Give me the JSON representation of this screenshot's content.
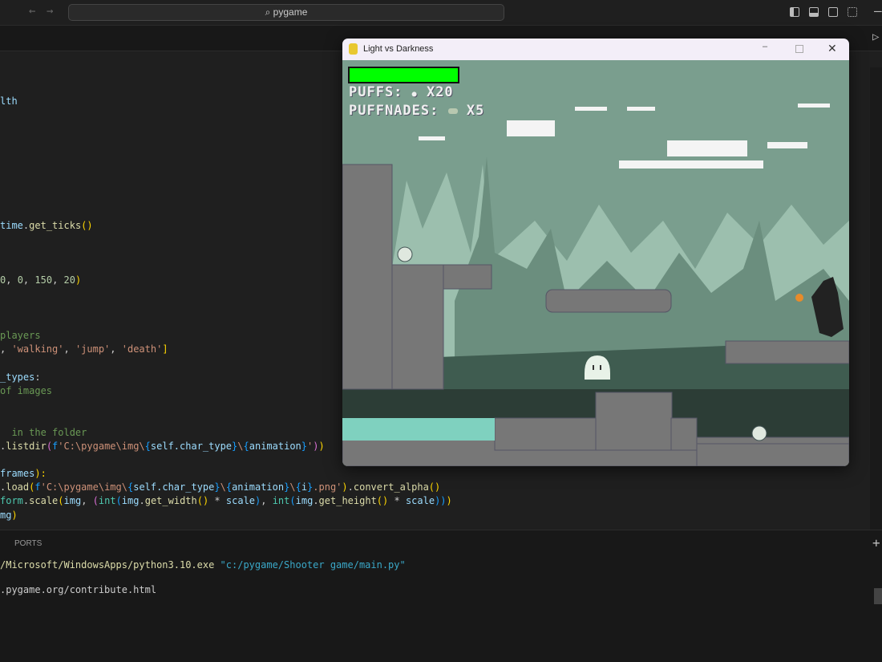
{
  "editor_titlebar": {
    "search_text": "pygame"
  },
  "code_lines": [
    {
      "parts": [
        [
          "k",
          "lth"
        ]
      ]
    },
    {
      "parts": [
        [
          "k",
          "time"
        ],
        [
          "w",
          "."
        ],
        [
          "f",
          "get_ticks"
        ],
        [
          "y",
          "()"
        ]
      ]
    },
    {
      "parts": [
        [
          "n",
          "0"
        ],
        [
          "w",
          ", "
        ],
        [
          "n",
          "0"
        ],
        [
          "w",
          ", "
        ],
        [
          "n",
          "150"
        ],
        [
          "w",
          ", "
        ],
        [
          "n",
          "20"
        ],
        [
          "y",
          ")"
        ]
      ]
    },
    {
      "parts": [
        [
          "c",
          "players"
        ]
      ]
    },
    {
      "parts": [
        [
          "w",
          ", "
        ],
        [
          "s",
          "'walking'"
        ],
        [
          "w",
          ", "
        ],
        [
          "s",
          "'jump'"
        ],
        [
          "w",
          ", "
        ],
        [
          "s",
          "'death'"
        ],
        [
          "y",
          "]"
        ]
      ]
    },
    {
      "parts": [
        [
          "k",
          "_types"
        ],
        [
          "w",
          ":"
        ]
      ]
    },
    {
      "parts": [
        [
          "c",
          "of images"
        ]
      ]
    },
    {
      "parts": [
        [
          "c",
          "  in the folder"
        ]
      ]
    },
    {
      "parts": [
        [
          "w",
          "."
        ],
        [
          "f",
          "listdir"
        ],
        [
          "p",
          "("
        ],
        [
          "b",
          "f"
        ],
        [
          "s",
          "'C:\\pygame\\img\\"
        ],
        [
          "b",
          "{"
        ],
        [
          "k",
          "self.char_type"
        ],
        [
          "b",
          "}"
        ],
        [
          "s",
          "\\"
        ],
        [
          "b",
          "{"
        ],
        [
          "k",
          "animation"
        ],
        [
          "b",
          "}"
        ],
        [
          "s",
          "'"
        ],
        [
          "p",
          ")"
        ],
        [
          "y",
          ")"
        ]
      ]
    },
    {
      "parts": [
        [
          "k",
          "frames"
        ],
        [
          "y",
          "):"
        ]
      ]
    },
    {
      "parts": [
        [
          "w",
          "."
        ],
        [
          "f",
          "load"
        ],
        [
          "y",
          "("
        ],
        [
          "b",
          "f"
        ],
        [
          "s",
          "'C:\\pygame\\img\\"
        ],
        [
          "b",
          "{"
        ],
        [
          "k",
          "self.char_type"
        ],
        [
          "b",
          "}"
        ],
        [
          "s",
          "\\"
        ],
        [
          "b",
          "{"
        ],
        [
          "k",
          "animation"
        ],
        [
          "b",
          "}"
        ],
        [
          "s",
          "\\"
        ],
        [
          "b",
          "{"
        ],
        [
          "k",
          "i"
        ],
        [
          "b",
          "}"
        ],
        [
          "s",
          ".png'"
        ],
        [
          "y",
          ")"
        ],
        [
          "w",
          "."
        ],
        [
          "f",
          "convert_alpha"
        ],
        [
          "y",
          "()"
        ]
      ]
    },
    {
      "parts": [
        [
          "t",
          "form"
        ],
        [
          "w",
          "."
        ],
        [
          "f",
          "scale"
        ],
        [
          "y",
          "("
        ],
        [
          "k",
          "img"
        ],
        [
          "w",
          ", "
        ],
        [
          "p",
          "("
        ],
        [
          "t",
          "int"
        ],
        [
          "b",
          "("
        ],
        [
          "k",
          "img"
        ],
        [
          "w",
          "."
        ],
        [
          "f",
          "get_width"
        ],
        [
          "y",
          "()"
        ],
        [
          "w",
          " * "
        ],
        [
          "k",
          "scale"
        ],
        [
          "b",
          ")"
        ],
        [
          "w",
          ", "
        ],
        [
          "t",
          "int"
        ],
        [
          "b",
          "("
        ],
        [
          "k",
          "img"
        ],
        [
          "w",
          "."
        ],
        [
          "f",
          "get_height"
        ],
        [
          "y",
          "()"
        ],
        [
          "w",
          " * "
        ],
        [
          "k",
          "scale"
        ],
        [
          "b",
          "))"
        ],
        [
          "y",
          ")"
        ]
      ]
    },
    {
      "parts": [
        [
          "k",
          "mg"
        ],
        [
          "y",
          ")"
        ]
      ]
    }
  ],
  "panel": {
    "tab_ports": "PORTS",
    "terminal_line1_a": "/Microsoft/WindowsApps/python3.10.exe",
    "terminal_line1_b": "\"c:/pygame/Shooter game/main.py\"",
    "terminal_line2": ".pygame.org/contribute.html"
  },
  "game_window": {
    "title": "Light vs Darkness",
    "health_fraction": 1.0,
    "hud_puffs_label": "PUFFS:",
    "hud_puffs_count": "X20",
    "hud_puffnades_label": "PUFFNADES:",
    "hud_puffnades_count": "X5"
  },
  "colors": {
    "health": "#00ff00",
    "sky": "#7a9e8e",
    "water": "#7fd1bf"
  }
}
